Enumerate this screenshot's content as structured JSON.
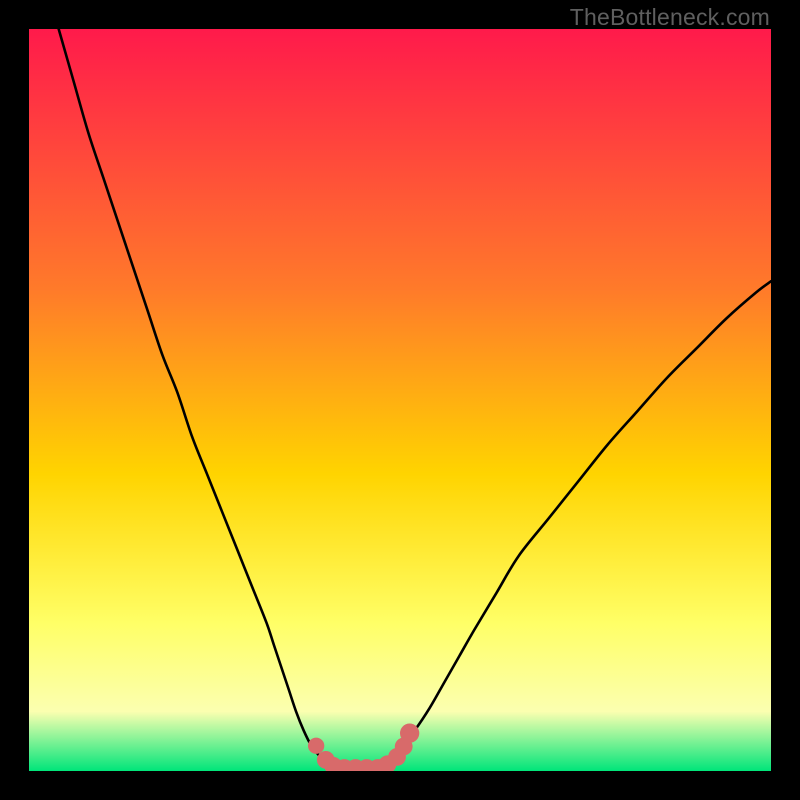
{
  "watermark": "TheBottleneck.com",
  "colors": {
    "bg": "#000000",
    "grad_top": "#ff1a4b",
    "grad_mid1": "#ff7a2a",
    "grad_mid2": "#ffd400",
    "grad_mid3": "#ffff66",
    "grad_mid4": "#fbffb0",
    "grad_bottom": "#00e57a",
    "curve": "#000000",
    "marker": "#d86a6a"
  },
  "chart_data": {
    "type": "line",
    "title": "",
    "xlabel": "",
    "ylabel": "",
    "xlim": [
      0,
      100
    ],
    "ylim": [
      0,
      100
    ],
    "series": [
      {
        "name": "bottleneck-curve",
        "x": [
          4,
          6,
          8,
          10,
          12,
          14,
          16,
          18,
          20,
          22,
          24,
          26,
          28,
          30,
          32,
          33,
          34,
          35,
          36,
          37,
          38,
          39,
          40,
          41,
          42,
          43,
          44,
          45,
          46,
          47,
          48,
          49,
          50,
          52,
          54,
          56,
          58,
          60,
          63,
          66,
          70,
          74,
          78,
          82,
          86,
          90,
          94,
          98,
          100
        ],
        "y": [
          100,
          93,
          86,
          80,
          74,
          68,
          62,
          56,
          51,
          45,
          40,
          35,
          30,
          25,
          20,
          17,
          14,
          11,
          8,
          5.5,
          3.5,
          2.2,
          1.3,
          0.8,
          0.5,
          0.4,
          0.4,
          0.4,
          0.5,
          0.7,
          1.1,
          1.8,
          3,
          5.5,
          8.5,
          12,
          15.5,
          19,
          24,
          29,
          34,
          39,
          44,
          48.5,
          53,
          57,
          61,
          64.5,
          66
        ]
      }
    ],
    "markers": {
      "name": "highlighted-range",
      "x": [
        38.7,
        40.0,
        41.0,
        42.5,
        44.0,
        45.5,
        47.0,
        48.3,
        49.6,
        50.5,
        51.3
      ],
      "y": [
        3.4,
        1.5,
        0.7,
        0.4,
        0.4,
        0.4,
        0.4,
        0.9,
        1.9,
        3.3,
        5.1
      ],
      "r": [
        1.1,
        1.2,
        1.2,
        1.2,
        1.2,
        1.2,
        1.2,
        1.2,
        1.2,
        1.2,
        1.3
      ]
    }
  }
}
